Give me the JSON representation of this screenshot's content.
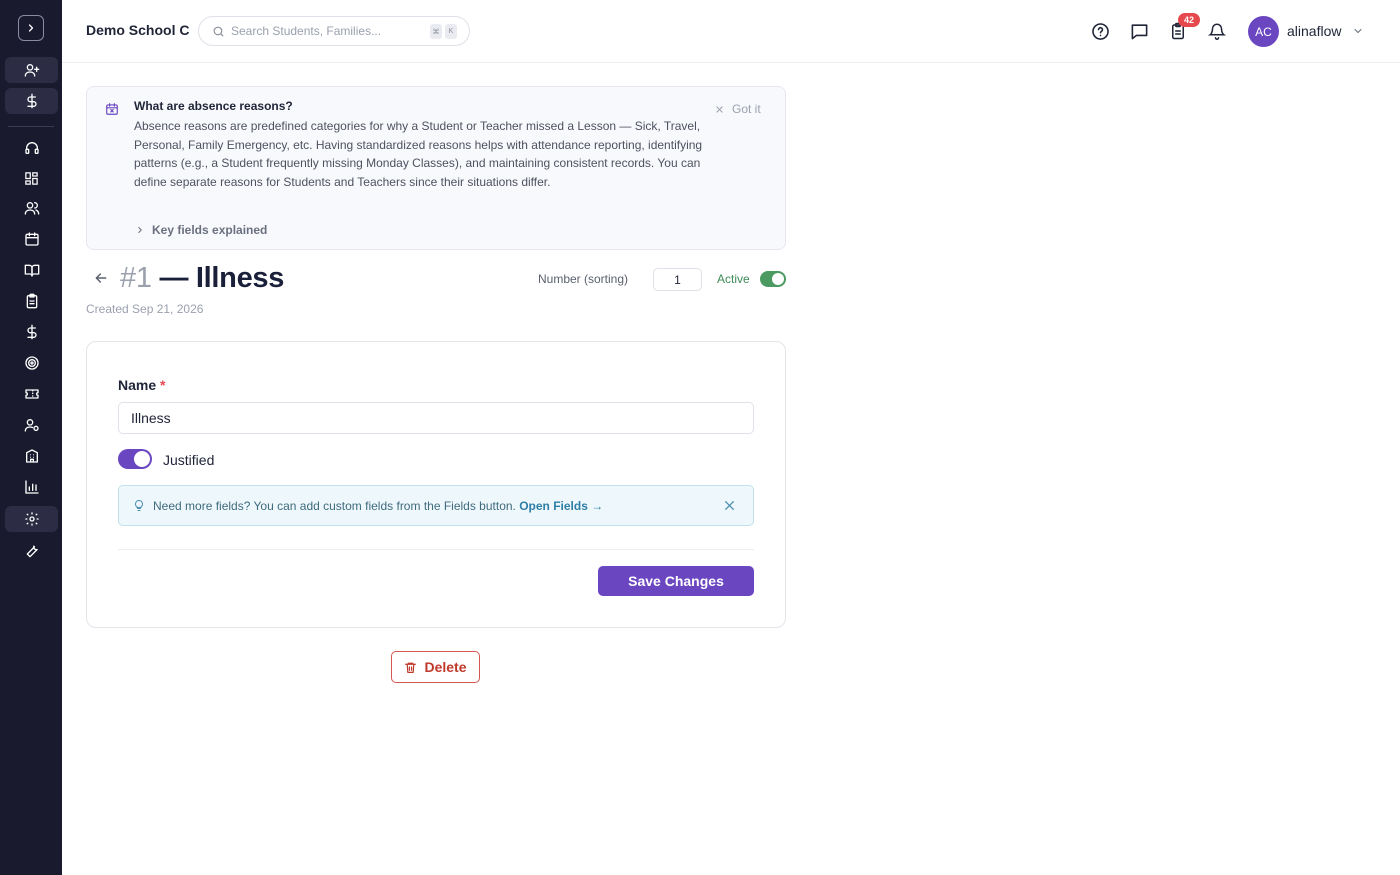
{
  "header": {
    "school_name": "Demo School C",
    "search_placeholder": "Search Students, Families...",
    "shortcut_keys": [
      "⌘",
      "K"
    ],
    "tasks_badge": "42",
    "user_initials": "AC",
    "username": "alinaflow"
  },
  "info": {
    "title": "What are absence reasons?",
    "body": "Absence reasons are predefined categories for why a Student or Teacher missed a Lesson — Sick, Travel, Personal, Family Emergency, etc. Having standardized reasons helps with attendance reporting, identifying patterns (e.g., a Student frequently missing Monday Classes), and maintaining consistent records. You can define separate reasons for Students and Teachers since their situations differ.",
    "dismiss_label": "Got it",
    "key_fields_label": "Key fields explained"
  },
  "record": {
    "number": "#1",
    "title": "— Illness",
    "created": "Created Sep 21, 2026",
    "sort_label": "Number (sorting)",
    "sort_value": "1",
    "active_label": "Active",
    "active": true
  },
  "form": {
    "name_label": "Name",
    "required_mark": "*",
    "name_value": "Illness",
    "justified_label": "Justified",
    "justified": true,
    "tip_text": "Need more fields? You can add custom fields from the Fields button.",
    "tip_link": "Open Fields →",
    "save_label": "Save Changes",
    "delete_label": "Delete"
  },
  "colors": {
    "accent": "#6b46c1",
    "active_green": "#4a9a62",
    "danger": "#c0392b",
    "sidebar_bg": "#1a1a2e"
  }
}
